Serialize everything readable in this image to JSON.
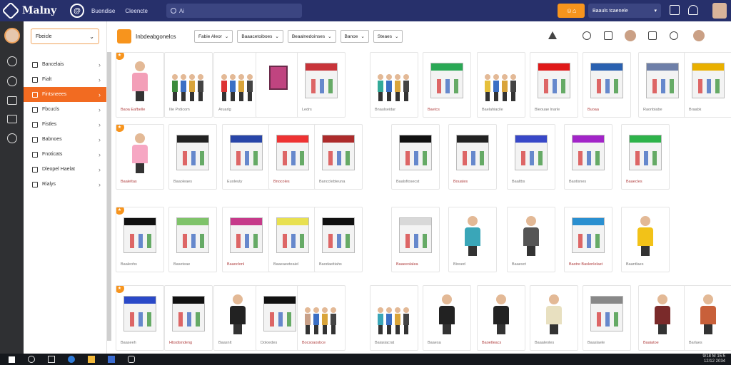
{
  "header": {
    "logo_text": "Malny",
    "brand_mark": "@",
    "nav": [
      "Buendise",
      "Cleencte"
    ],
    "search_text": "Ai",
    "orange_button_label": "☺⌂",
    "account_label": "Baauls tcaenele",
    "icons": [
      "calendar-icon",
      "bell-icon",
      "avatar"
    ]
  },
  "rail": {
    "icons": [
      "avatar",
      "globe-icon",
      "refresh-icon",
      "home-icon",
      "store-icon",
      "cloud-icon"
    ]
  },
  "sidebar": {
    "select_label": "Fbeicle",
    "items": [
      {
        "label": "Bancelais",
        "active": false
      },
      {
        "label": "Fialt",
        "active": false
      },
      {
        "label": "Fintsneees",
        "active": true
      },
      {
        "label": "Fbcucls",
        "active": false
      },
      {
        "label": "Fistles",
        "active": false
      },
      {
        "label": "Babnoes",
        "active": false
      },
      {
        "label": "Fnoticats",
        "active": false
      },
      {
        "label": "Dleopel Haelat",
        "active": false
      },
      {
        "label": "Rialys",
        "active": false
      }
    ]
  },
  "toolbar": {
    "title": "Inbdeabgonelcs",
    "filters": [
      "Fabie Aleor",
      "Baaacetoiboes",
      "Beaalnedoinses",
      "Banoe",
      "Steaes"
    ],
    "right_icons": [
      "warning-icon",
      "share-icon",
      "document-icon",
      "avatar",
      "user-icon",
      "scissors-icon",
      "avatar"
    ]
  },
  "cards": [
    {
      "caption": "Baoa Eafbelle",
      "kind": "bigfig",
      "color": "#f39fb8"
    },
    {
      "caption": "Ilie Prdicom",
      "kind": "group",
      "color": "#3c8b3c"
    },
    {
      "caption": "Aruarlg",
      "kind": "group",
      "color": "#d33"
    },
    {
      "caption": "",
      "kind": "bag",
      "color": "#c04480"
    },
    {
      "caption": "Ledrs",
      "kind": "shop",
      "color": "#c8343a"
    },
    {
      "caption": "Bnaulseidar",
      "kind": "group",
      "color": "#3a9"
    },
    {
      "caption": "Baetcs",
      "kind": "shop",
      "color": "#2aa855"
    },
    {
      "caption": "Baelahiacile",
      "kind": "group",
      "color": "#e6c03a"
    },
    {
      "caption": "Bleouae lnarle",
      "kind": "shop",
      "color": "#e01919"
    },
    {
      "caption": "Buoaa",
      "kind": "shop",
      "color": "#2a61b0"
    },
    {
      "caption": "Raonbiabe",
      "kind": "shop",
      "color": "#6e7fa8"
    },
    {
      "caption": "Braabk",
      "kind": "shop",
      "color": "#e9b000"
    },
    {
      "caption": "Baaleltas",
      "kind": "bigfig",
      "color": "#f6a7c3"
    },
    {
      "caption": "Baaoleaes",
      "kind": "shop",
      "color": "#222"
    },
    {
      "caption": "Euoleuty",
      "kind": "shop",
      "color": "#2845a8"
    },
    {
      "caption": "Bnocoles",
      "kind": "shop",
      "color": "#e33"
    },
    {
      "caption": "Bancclebteuna",
      "kind": "shop",
      "color": "#ad2b2b"
    },
    {
      "caption": "Baalsfiosecst",
      "kind": "shop",
      "color": "#111"
    },
    {
      "caption": "Bouates",
      "kind": "shop",
      "color": "#222"
    },
    {
      "caption": "Baaltbs",
      "kind": "shop",
      "color": "#3848c8"
    },
    {
      "caption": "Baotisnes",
      "kind": "shop",
      "color": "#a224c8"
    },
    {
      "caption": "Baaecles",
      "kind": "shop",
      "color": "#2eb34a"
    },
    {
      "caption": "Baaleohs",
      "kind": "shop",
      "color": "#111"
    },
    {
      "caption": "Baseteae",
      "kind": "shop",
      "color": "#7fc36a"
    },
    {
      "caption": "Baaoclonl",
      "kind": "shop",
      "color": "#c63a8a"
    },
    {
      "caption": "Baaeaeeteaiel",
      "kind": "shop",
      "color": "#e8e050"
    },
    {
      "caption": "Baodaeitiahs",
      "kind": "shop",
      "color": "#111"
    },
    {
      "caption": "Baaeeolalea",
      "kind": "shop",
      "color": "#d8d8d8"
    },
    {
      "caption": "Biosed",
      "kind": "bigfig",
      "color": "#3aa6b8"
    },
    {
      "caption": "Baaesct",
      "kind": "bigfig",
      "color": "#555"
    },
    {
      "caption": "Bastre Baslenlelast",
      "kind": "shop",
      "color": "#2a8fd0"
    },
    {
      "caption": "Baantlaes",
      "kind": "bigfig",
      "color": "#f2c218"
    },
    {
      "caption": "Baaseeh",
      "kind": "shop",
      "color": "#2a49c8"
    },
    {
      "caption": "Hbsdisndeng",
      "kind": "shop",
      "color": "#111"
    },
    {
      "caption": "Baasnlt",
      "kind": "bigfig",
      "color": "#222"
    },
    {
      "caption": "Doloedes",
      "kind": "shop",
      "color": "#111"
    },
    {
      "caption": "Bocsoaosbce",
      "kind": "group",
      "color": "#c8a088"
    },
    {
      "caption": "Baiasiacrat",
      "kind": "group",
      "color": "#3aa6b8"
    },
    {
      "caption": "Baaesa",
      "kind": "bigfig",
      "color": "#222"
    },
    {
      "caption": "Baoetleacs",
      "kind": "bigfig",
      "color": "#222"
    },
    {
      "caption": "Baaaleoles",
      "kind": "bigfig",
      "color": "#e8e0c0"
    },
    {
      "caption": "Baaslaele",
      "kind": "shop",
      "color": "#888"
    },
    {
      "caption": "Baaiatoe",
      "kind": "bigfig",
      "color": "#7a2a2a"
    },
    {
      "caption": "Barlaes",
      "kind": "bigfig",
      "color": "#c8603a"
    }
  ],
  "taskbar": {
    "clock_time": "9/18 M 15:5",
    "clock_date": "12/12 2034"
  }
}
